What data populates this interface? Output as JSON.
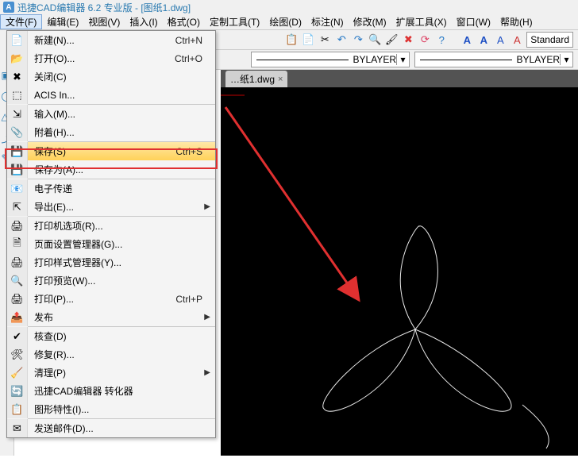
{
  "title": "迅捷CAD编辑器 6.2 专业版 - [图纸1.dwg]",
  "logo_letter": "A",
  "menubar": {
    "file": "文件(F)",
    "edit": "编辑(E)",
    "view": "视图(V)",
    "insert": "插入(I)",
    "format": "格式(O)",
    "custom": "定制工具(T)",
    "draw": "绘图(D)",
    "dim": "标注(N)",
    "modify": "修改(M)",
    "exttool": "扩展工具(X)",
    "window": "窗口(W)",
    "help": "帮助(H)"
  },
  "toolbar": {
    "style_text": "Standard",
    "letter_a": "A"
  },
  "layerbar": {
    "bylayer1": "BYLAYER",
    "bylayer2": "BYLAYER"
  },
  "tabs": {
    "doc": "…纸1.dwg",
    "close": "×"
  },
  "file_menu": {
    "new": {
      "label": "新建(N)...",
      "shortcut": "Ctrl+N"
    },
    "open": {
      "label": "打开(O)...",
      "shortcut": "Ctrl+O"
    },
    "close": {
      "label": "关闭(C)",
      "shortcut": ""
    },
    "acis": {
      "label": "ACIS In...",
      "shortcut": ""
    },
    "import": {
      "label": "输入(M)...",
      "shortcut": ""
    },
    "attach": {
      "label": "附着(H)...",
      "shortcut": ""
    },
    "save": {
      "label": "保存(S)",
      "shortcut": "Ctrl+S"
    },
    "saveas": {
      "label": "保存为(A)...",
      "shortcut": ""
    },
    "etransmit": {
      "label": "电子传递",
      "shortcut": ""
    },
    "export": {
      "label": "导出(E)...",
      "shortcut": ""
    },
    "printopt": {
      "label": "打印机选项(R)...",
      "shortcut": ""
    },
    "pagesetup": {
      "label": "页面设置管理器(G)...",
      "shortcut": ""
    },
    "plotstyle": {
      "label": "打印样式管理器(Y)...",
      "shortcut": ""
    },
    "preview": {
      "label": "打印预览(W)...",
      "shortcut": ""
    },
    "print": {
      "label": "打印(P)...",
      "shortcut": "Ctrl+P"
    },
    "publish": {
      "label": "发布",
      "shortcut": ""
    },
    "audit": {
      "label": "核查(D)",
      "shortcut": ""
    },
    "recover": {
      "label": "修复(R)...",
      "shortcut": ""
    },
    "purge": {
      "label": "清理(P)",
      "shortcut": ""
    },
    "converter": {
      "label": "迅捷CAD编辑器 转化器",
      "shortcut": ""
    },
    "drawprops": {
      "label": "图形特性(I)...",
      "shortcut": ""
    },
    "sendmail": {
      "label": "发送邮件(D)...",
      "shortcut": ""
    }
  },
  "icon_glyphs": {
    "new": "📄",
    "open": "📂",
    "close": "✖",
    "acis": "⬚",
    "import": "⇲",
    "attach": "📎",
    "save": "💾",
    "saveas": "💾",
    "etransmit": "📧",
    "export": "⇱",
    "printopt": "🖨",
    "pagesetup": "🗎",
    "plotstyle": "🖨",
    "preview": "🔍",
    "print": "🖨",
    "publish": "📤",
    "audit": "✔",
    "recover": "🛠",
    "purge": "🧹",
    "converter": "🔄",
    "drawprops": "📋",
    "sendmail": "✉"
  }
}
